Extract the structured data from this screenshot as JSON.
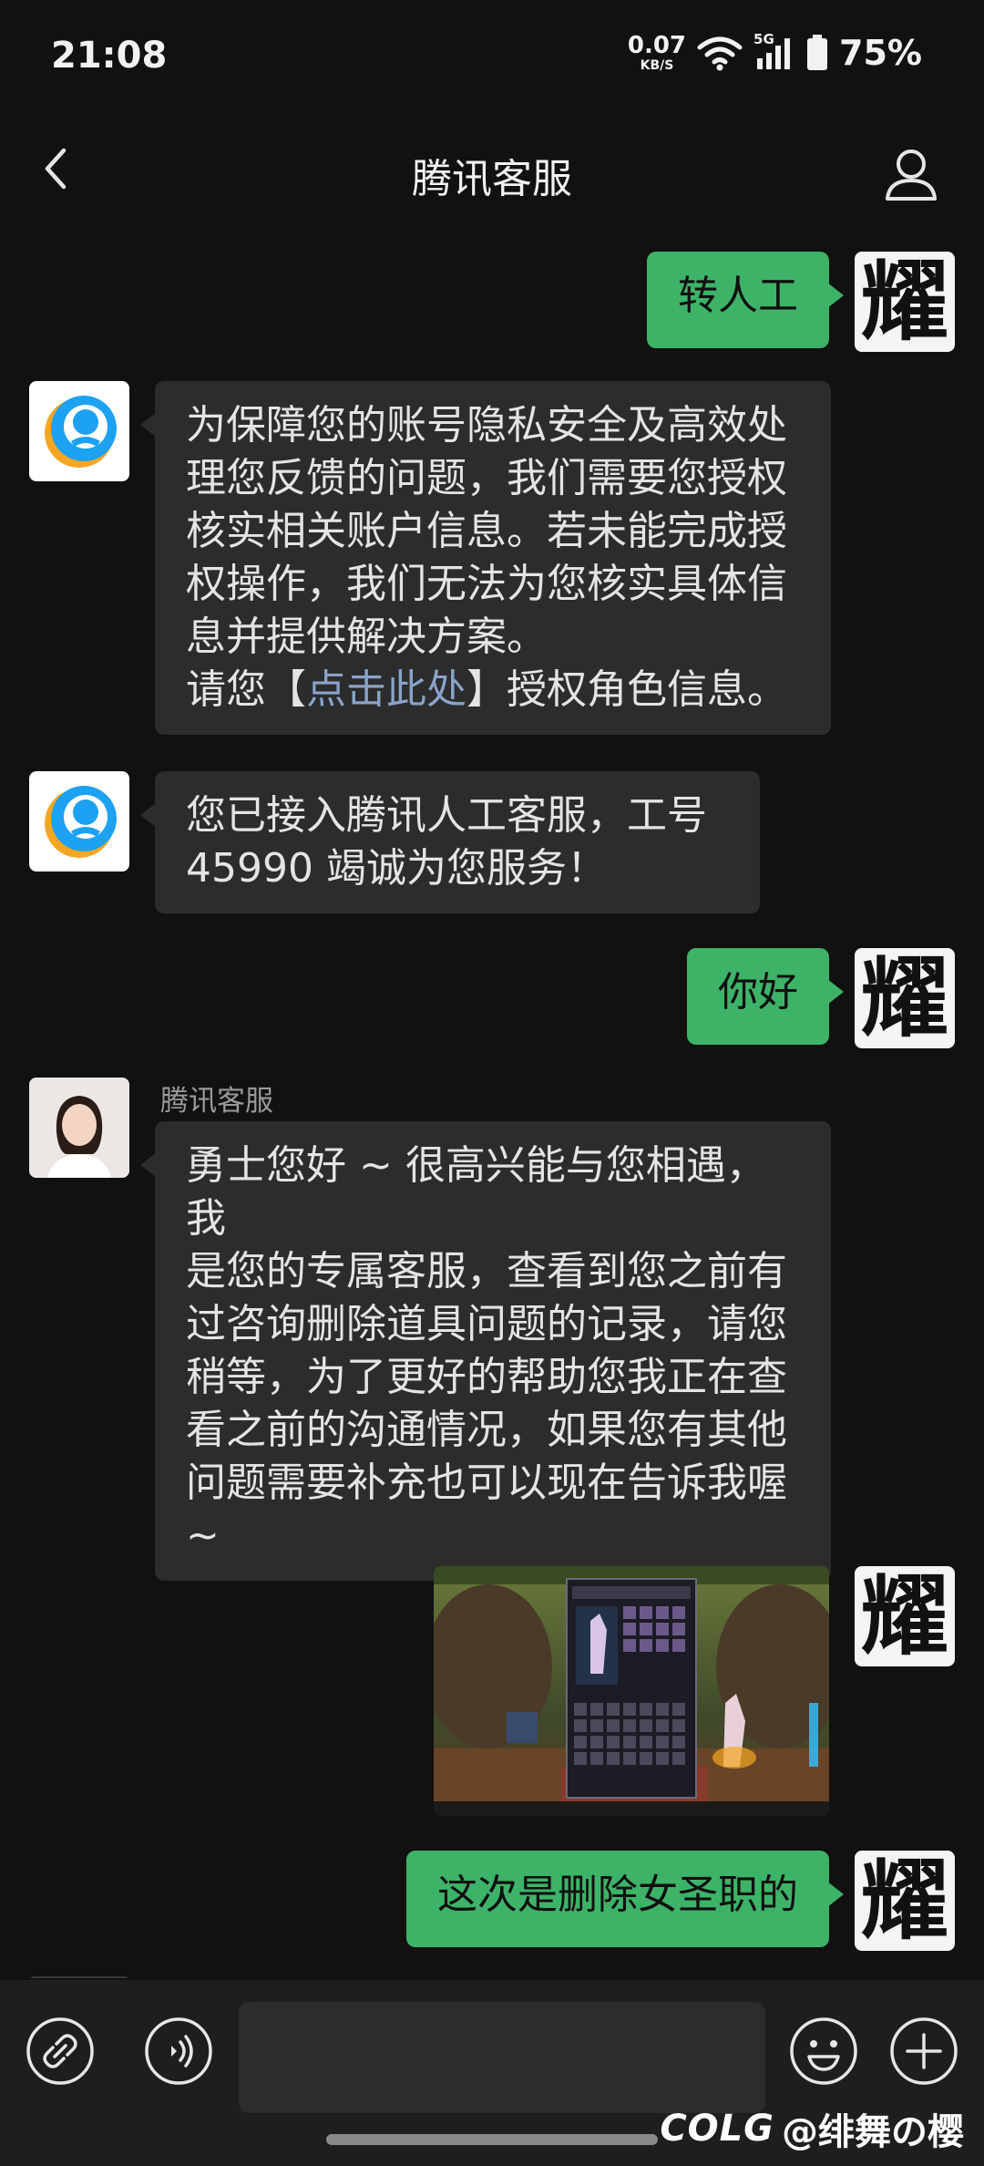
{
  "status_bar": {
    "time": "21:08",
    "net_speed_value": "0.07",
    "net_speed_unit": "KB/S",
    "network_type": "5G",
    "battery": "75%"
  },
  "header": {
    "title": "腾讯客服",
    "back_icon": "chevron-left-icon",
    "profile_icon": "person-icon"
  },
  "messages": [
    {
      "from": "me",
      "text": "转人工"
    },
    {
      "from": "bot",
      "lines": [
        "为保障您的账号隐私安全及高效处",
        "理您反馈的问题，我们需要您授权",
        "核实相关账户信息。若未能完成授",
        "权操作，我们无法为您核实具体信",
        "息并提供解决方案。"
      ],
      "last_line_prefix": "请您【",
      "link_text": "点击此处",
      "last_line_suffix": "】授权角色信息。"
    },
    {
      "from": "bot",
      "lines": [
        "您已接入腾讯人工客服，工号",
        "45990 竭诚为您服务！"
      ]
    },
    {
      "from": "me",
      "text": "你好"
    },
    {
      "from": "agent",
      "sender": "腾讯客服",
      "lines": [
        "勇士您好 ~ 很高兴能与您相遇，我",
        "是您的专属客服，查看到您之前有",
        "过咨询删除道具问题的记录，请您",
        "稍等，为了更好的帮助您我正在查",
        "看之前的沟通情况，如果您有其他",
        "问题需要补充也可以现在告诉我喔",
        "~"
      ]
    },
    {
      "from": "me",
      "type": "image",
      "alt_icon": "game-screenshot-thumbnail"
    },
    {
      "from": "me",
      "text": "这次是删除女圣职的"
    }
  ],
  "user_avatar_char": "耀",
  "input_bar": {
    "link_icon": "link-icon",
    "voice_icon": "voice-icon",
    "emoji_icon": "emoji-icon",
    "plus_icon": "plus-icon"
  },
  "watermark": {
    "brand": "COLG",
    "handle": "@绯舞の樱"
  },
  "colors": {
    "background": "#111111",
    "my_bubble": "#3db368",
    "other_bubble": "#2c2c2c",
    "link": "#8aa3c8",
    "input_bar": "#1e1e1e"
  }
}
